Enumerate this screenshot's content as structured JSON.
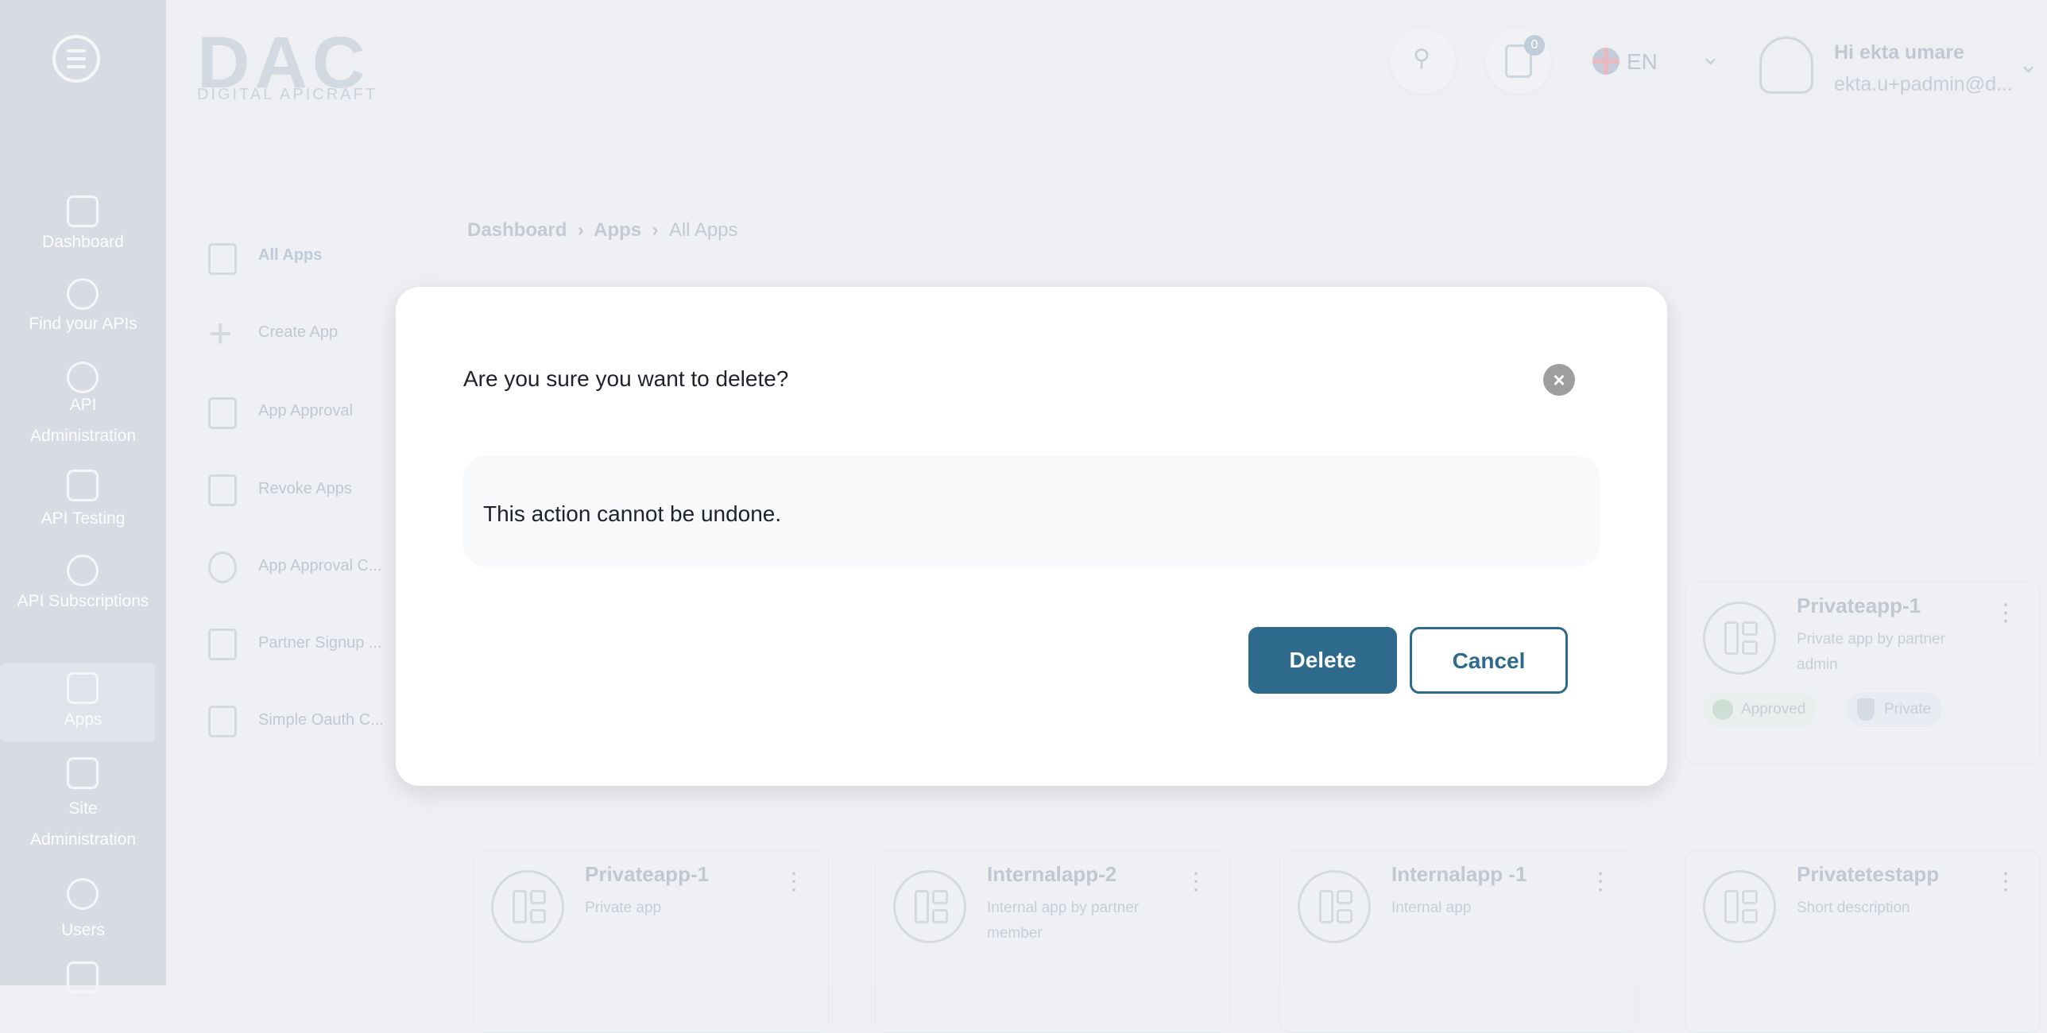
{
  "brand": {
    "logo": "DAC",
    "logo_sub": "DIGITAL APICRAFT"
  },
  "header": {
    "notification_count": "0",
    "language": "EN",
    "user_greeting": "Hi ekta umare",
    "user_email": "ekta.u+padmin@d..."
  },
  "sidebar": {
    "items": [
      {
        "label": "Dashboard"
      },
      {
        "label": "Find your APIs"
      },
      {
        "label": "API Administration"
      },
      {
        "label": "API Testing"
      },
      {
        "label": "API Subscriptions"
      },
      {
        "label": "Apps"
      },
      {
        "label": "Site Administration"
      },
      {
        "label": "Users"
      }
    ]
  },
  "subnav": {
    "items": [
      {
        "label": "All Apps"
      },
      {
        "label": "Create App"
      },
      {
        "label": "App Approval"
      },
      {
        "label": "Revoke Apps"
      },
      {
        "label": "App Approval C..."
      },
      {
        "label": "Partner Signup ..."
      },
      {
        "label": "Simple Oauth C..."
      }
    ]
  },
  "breadcrumb": [
    "Dashboard",
    "Apps",
    "All Apps"
  ],
  "cards": [
    {
      "title": "Privateapp-1",
      "desc": "Private app by partner admin",
      "badges": [
        "Approved",
        "Private"
      ]
    },
    {
      "title": "Privateapp-1",
      "desc": "Private app"
    },
    {
      "title": "Internalapp-2",
      "desc": "Internal app by partner member"
    },
    {
      "title": "Internalapp -1",
      "desc": "Internal app"
    },
    {
      "title": "Privatetestapp",
      "desc": "Short description"
    }
  ],
  "modal": {
    "title": "Are you sure you want to delete?",
    "message": "This action cannot be undone.",
    "delete_label": "Delete",
    "cancel_label": "Cancel"
  },
  "colors": {
    "primary": "#2d6a8c",
    "close": "#9e9e9e"
  }
}
